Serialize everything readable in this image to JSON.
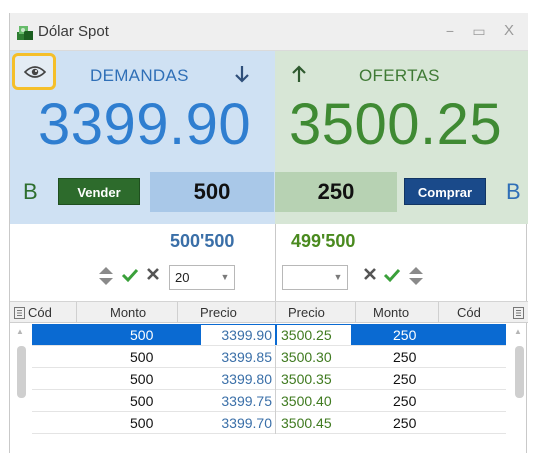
{
  "window": {
    "title": "Dólar Spot",
    "minimize_glyph": "−",
    "maximize_glyph": "▭",
    "close_glyph": "X"
  },
  "bid": {
    "label": "DEMANDAS",
    "price": "3399.90",
    "letter": "B",
    "action_label": "Vender",
    "quantity": "500",
    "total": "500'500",
    "filter_value": "20",
    "color": "#2f7ed0"
  },
  "ask": {
    "label": "OFERTAS",
    "price": "3500.25",
    "letter": "B",
    "action_label": "Comprar",
    "quantity": "250",
    "total": "499'500",
    "filter_value": "",
    "color": "#3f8a33"
  },
  "grid": {
    "columns": [
      "Cód",
      "Monto",
      "Precio",
      "Precio",
      "Monto",
      "Cód"
    ],
    "rows": [
      {
        "bid_cod": "",
        "bid_monto": "500",
        "bid_precio": "3399.90",
        "ask_precio": "3500.25",
        "ask_monto": "250",
        "ask_cod": "",
        "selected": true
      },
      {
        "bid_cod": "",
        "bid_monto": "500",
        "bid_precio": "3399.85",
        "ask_precio": "3500.30",
        "ask_monto": "250",
        "ask_cod": "",
        "selected": false
      },
      {
        "bid_cod": "",
        "bid_monto": "500",
        "bid_precio": "3399.80",
        "ask_precio": "3500.35",
        "ask_monto": "250",
        "ask_cod": "",
        "selected": false
      },
      {
        "bid_cod": "",
        "bid_monto": "500",
        "bid_precio": "3399.75",
        "ask_precio": "3500.40",
        "ask_monto": "250",
        "ask_cod": "",
        "selected": false
      },
      {
        "bid_cod": "",
        "bid_monto": "500",
        "bid_precio": "3399.70",
        "ask_precio": "3500.45",
        "ask_monto": "250",
        "ask_cod": "",
        "selected": false
      }
    ]
  },
  "icons": {
    "app": "money-stack-icon",
    "visibility": "eye-icon",
    "bid_arrow": "arrow-down-icon",
    "ask_arrow": "arrow-up-icon",
    "order": "sort-up-down-icon",
    "confirm": "check-icon",
    "clear": "x-icon",
    "dropdown": "chevron-down-icon",
    "column_menu": "list-menu-icon"
  },
  "colors": {
    "selection": "#0a6ad2",
    "highlight_border": "#f5bf2a",
    "sell_button": "#2d6b2c",
    "buy_button": "#1a4a8a"
  }
}
